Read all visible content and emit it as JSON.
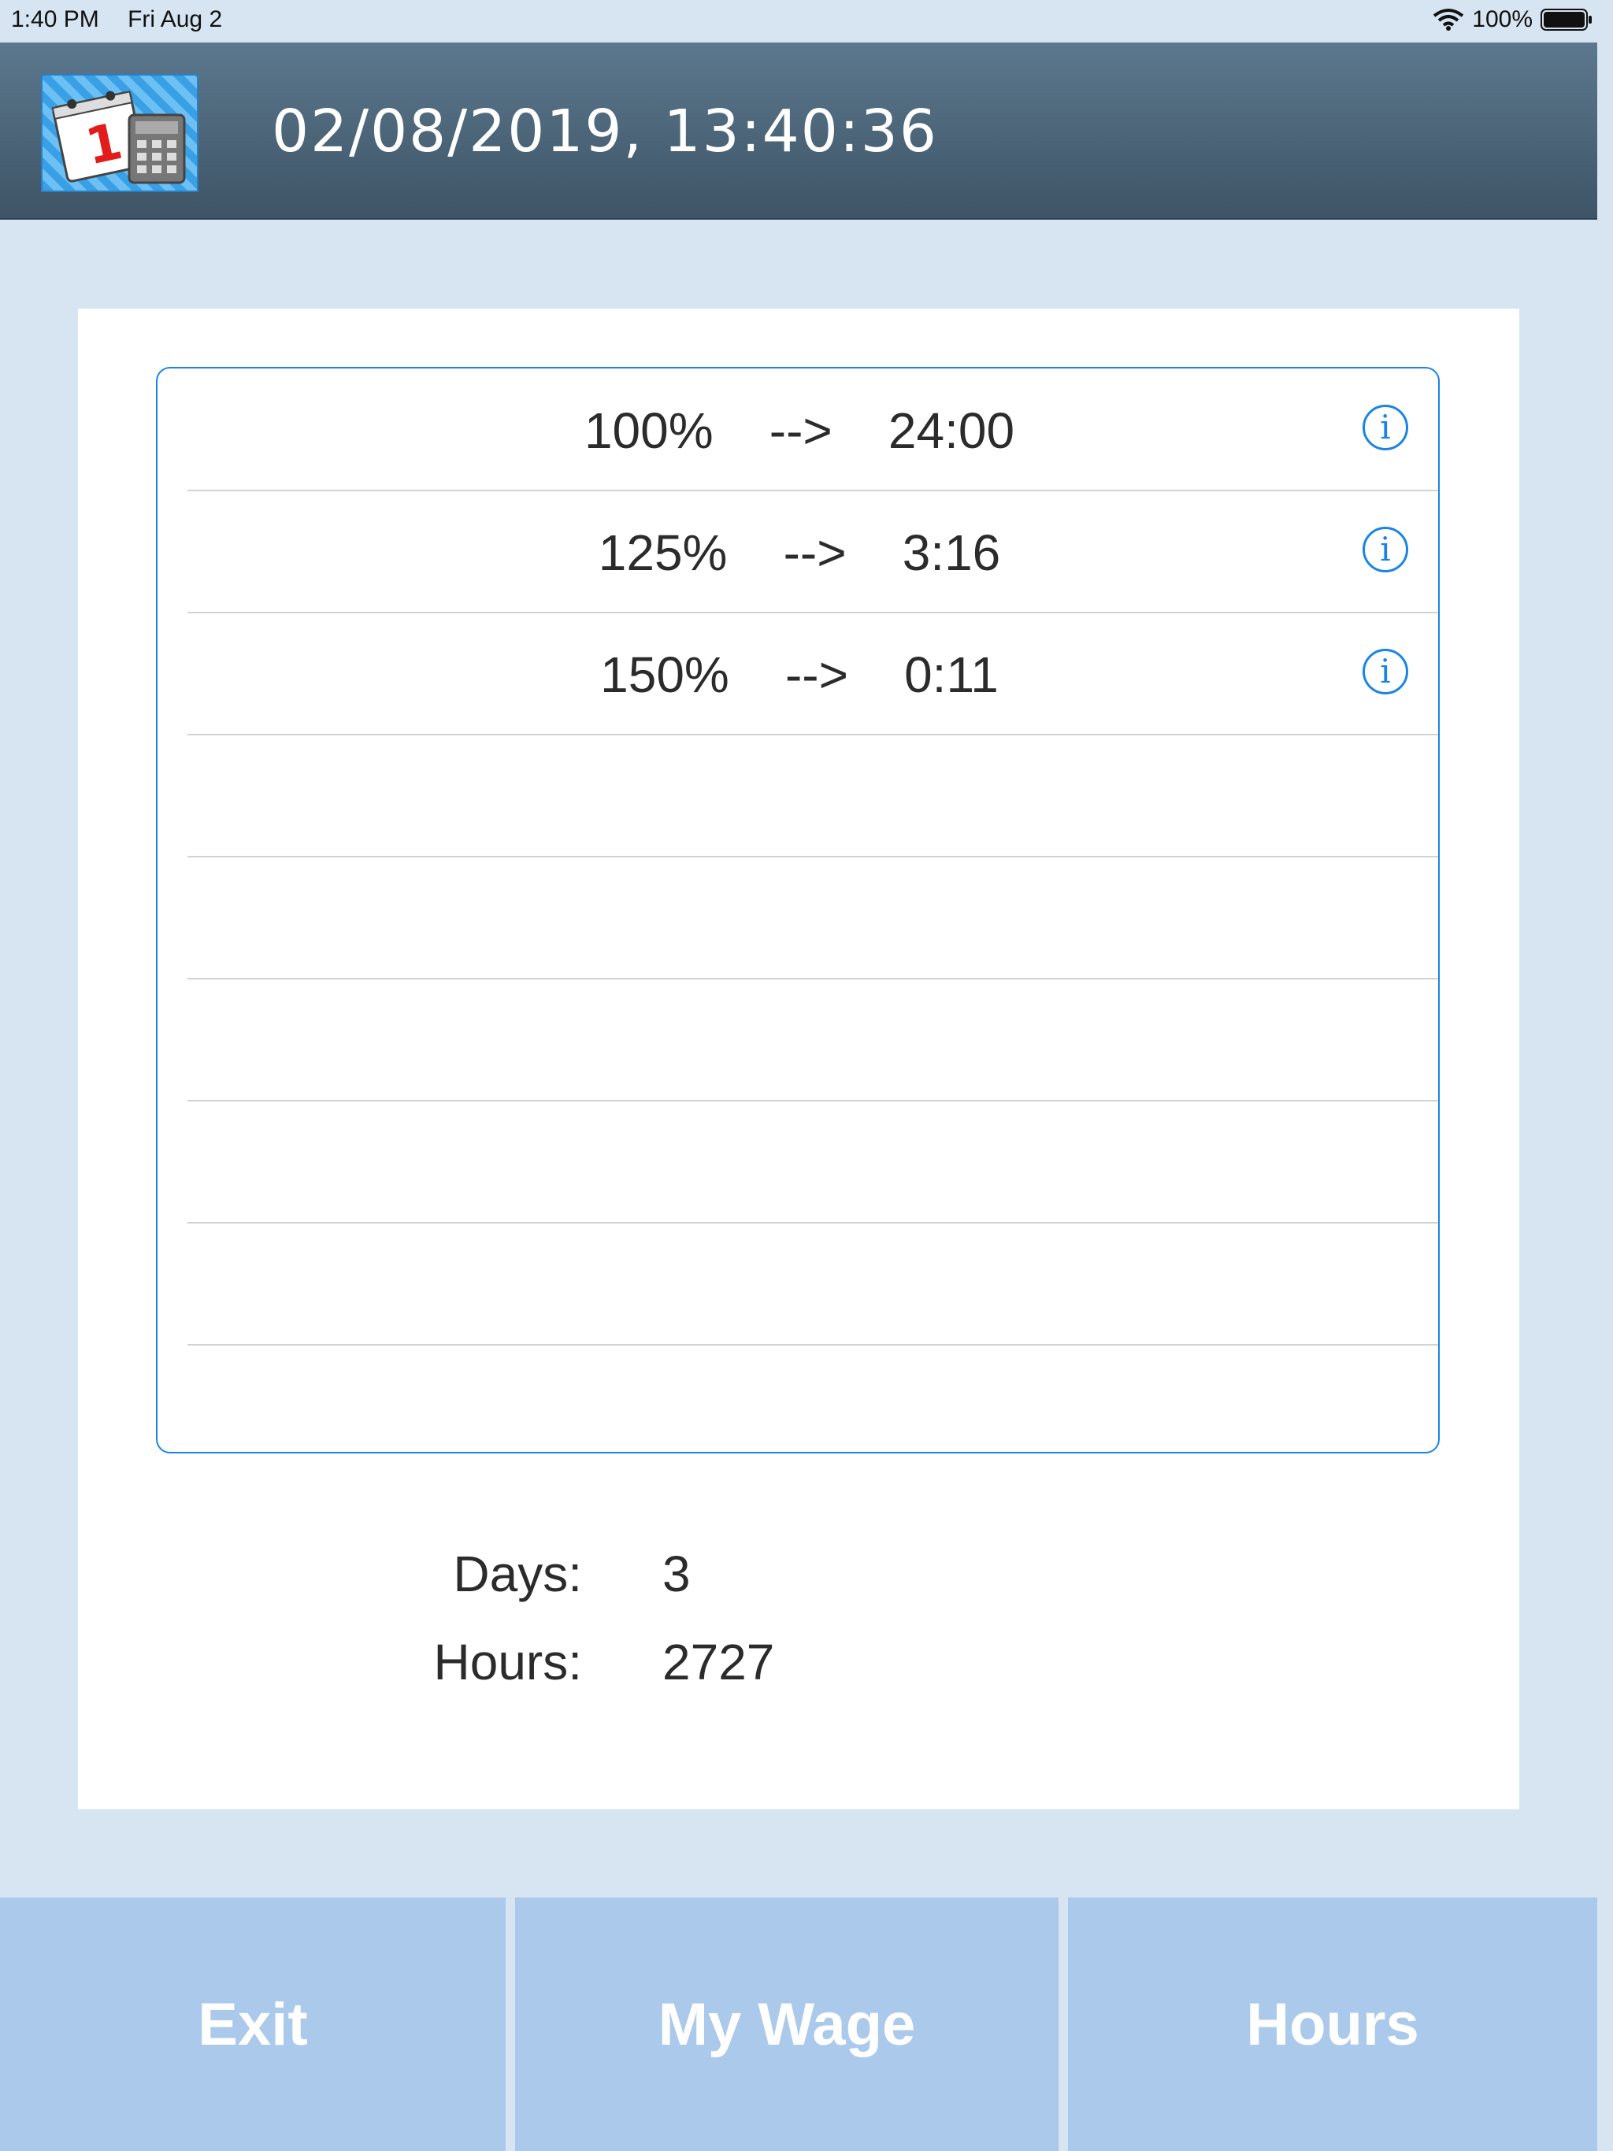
{
  "status_bar": {
    "time": "1:40 PM",
    "date": "Fri Aug 2",
    "battery": "100%",
    "icons": [
      "wifi-icon",
      "battery-icon"
    ]
  },
  "header": {
    "title": "02/08/2019, 13:40:36",
    "icon": "calendar-calculator-icon"
  },
  "rates": [
    {
      "text": "100%    -->    24:00",
      "icon": "info-icon"
    },
    {
      "text": "125%    -->    3:16",
      "icon": "info-icon"
    },
    {
      "text": "150%    -->    0:11",
      "icon": "info-icon"
    }
  ],
  "summary": {
    "days_label": "Days:",
    "days_value": "3",
    "hours_label": "Hours:",
    "hours_value": "2727"
  },
  "buttons": {
    "exit": "Exit",
    "my_wage": "My Wage",
    "hours": "Hours"
  },
  "colors": {
    "accent": "#1a84e6",
    "background": "#d7e4f1",
    "button": "#abc9eb"
  }
}
